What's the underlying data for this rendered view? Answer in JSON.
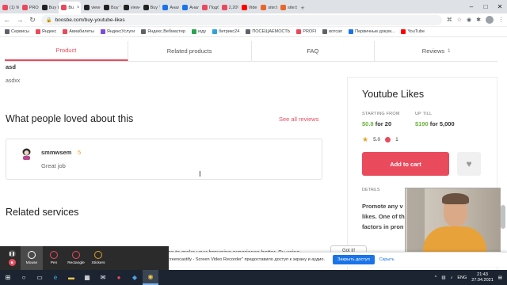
{
  "browser": {
    "tabs": [
      {
        "label": "(1) W",
        "color": "#e94a5c"
      },
      {
        "label": "PROF",
        "color": "#e94a5c"
      },
      {
        "label": "Buy I",
        "color": "#222"
      },
      {
        "label": "Bu",
        "color": "#e94a5c",
        "active": true
      },
      {
        "label": "view-",
        "color": "#222"
      },
      {
        "label": "Buy Y",
        "color": "#222"
      },
      {
        "label": "view-",
        "color": "#222"
      },
      {
        "label": "Buy T",
        "color": "#222"
      },
      {
        "label": "Анал",
        "color": "#1a73e8"
      },
      {
        "label": "Анал",
        "color": "#1a73e8"
      },
      {
        "label": "Подб",
        "color": "#e94a5c"
      },
      {
        "label": "2,20%",
        "color": "#e94a5c"
      },
      {
        "label": "Vide",
        "color": "#ff0000"
      },
      {
        "label": "site:b",
        "color": "#e9652b"
      },
      {
        "label": "site:b",
        "color": "#e9652b"
      }
    ],
    "url": "boosbe.com/buy-youtube-likes",
    "new_tab_symbol": "+",
    "window_controls": [
      "–",
      "□",
      "✕"
    ]
  },
  "bookmarks": [
    {
      "label": "Сервисы",
      "color": "#5f6368"
    },
    {
      "label": "Яндекс",
      "color": "#e94a5c"
    },
    {
      "label": "Авиабилеты",
      "color": "#e94a5c"
    },
    {
      "label": "ЯндексУслуги",
      "color": "#7b4cdb"
    },
    {
      "label": "Яндекс.Вебмастер",
      "color": "#5f6368"
    },
    {
      "label": "юду",
      "color": "#2aa44f"
    },
    {
      "label": "битрикс24",
      "color": "#2fa1dc"
    },
    {
      "label": "ПОСЕЩАЕМОСТЬ",
      "color": "#5f6368"
    },
    {
      "label": "PROFI",
      "color": "#e94a5c"
    },
    {
      "label": "вотсап",
      "color": "#5f6368"
    },
    {
      "label": "Первичные докум...",
      "color": "#1a73e8"
    },
    {
      "label": "YouTube",
      "color": "#ff0000"
    }
  ],
  "page": {
    "tabs": [
      {
        "label": "Product",
        "active": true
      },
      {
        "label": "Related products"
      },
      {
        "label": "FAQ"
      },
      {
        "label": "Reviews",
        "count": "1"
      }
    ],
    "review": {
      "title": "asd",
      "body": "asdxx"
    },
    "loved_title": "What people loved about this",
    "see_all": "See all reviews",
    "card": {
      "name": "smmwsem",
      "score": "5",
      "text": "Great job"
    },
    "related_title": "Related services",
    "cookie_text": "okies to make your browsing experience better. By using",
    "cookie_button": "Got it!"
  },
  "sidebar": {
    "title": "Youtube Likes",
    "starting_label": "STARTING FROM",
    "starting_price": "$0.8",
    "starting_qty": "for 20",
    "upto_label": "UP TILL",
    "upto_price": "$190",
    "upto_qty": "for 5,000",
    "rating": "5.0",
    "reviews": "1",
    "add_to_cart": "Add to cart",
    "details_label": "DETAILS",
    "details_text": "Promote any v likes. One of th factors in pron"
  },
  "screencastify": {
    "tools": [
      {
        "label": "Mouse",
        "color": "#ffffff",
        "selected": true
      },
      {
        "label": "Pen",
        "color": "#e94a5c"
      },
      {
        "label": "Rectangle",
        "color": "#e94a5c"
      },
      {
        "label": "Stickers",
        "color": "#e5a022"
      }
    ]
  },
  "share_bar": {
    "text": "Приложение \"Screencastify - Screen Video Recorder\" предоставило доступ к экрану и аудио.",
    "stop": "Закрыть доступ",
    "hide": "Скрыть"
  },
  "taskbar": {
    "lang": "ENG",
    "time": "21:43",
    "date": "27.04.2021"
  }
}
